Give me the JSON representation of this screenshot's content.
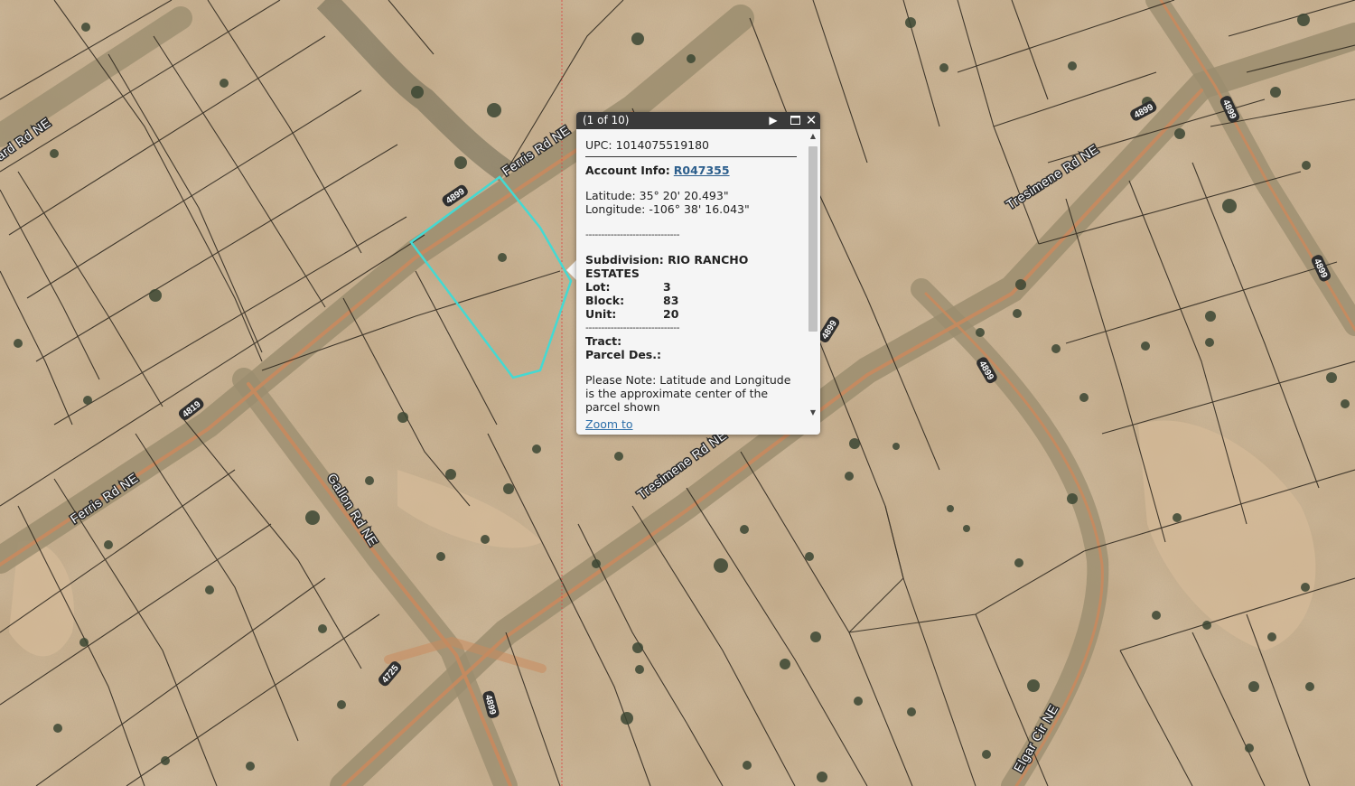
{
  "map": {
    "road_labels": {
      "ferris_top": "Ferris Rd NE",
      "ferris_bottom": "Ferris Rd NE",
      "tresimene_top": "Tresimene Rd NE",
      "tresimene_bottom": "Tresimene Rd NE",
      "gallon": "Gallon Rd NE",
      "elgar": "Elgar Cir NE",
      "partial_left": "ard Rd NE"
    },
    "route_numbers": {
      "r1": "4899",
      "r2": "4899",
      "r3": "4899",
      "r4": "4899",
      "r5": "4899",
      "r6": "4899",
      "r7": "4899",
      "r8": "4819",
      "r9": "4725",
      "r10": "4899"
    },
    "colors": {
      "terrain": "#c3a983",
      "parcel_line": "#1f1a14",
      "selected_parcel": "#3fd6d0",
      "road": "#9a8a6a",
      "dirt_track": "#c98a5d",
      "vegetation": "#3d4a35"
    }
  },
  "popup": {
    "counter": "(1 of 10)",
    "next_icon": "next-arrow-icon",
    "maximize_icon": "maximize-icon",
    "close_icon": "close-icon",
    "upc_label": "UPC:",
    "upc_value": "1014075519180",
    "account_label": "Account Info:",
    "account_value": "R047355",
    "latitude": "Latitude: 35° 20' 20.493\"",
    "longitude": "Longitude: -106° 38' 16.043\"",
    "divider": "------------------------------",
    "subdivision": "Subdivision: RIO RANCHO ESTATES",
    "lot_label": "Lot:",
    "lot_value": "3",
    "block_label": "Block:",
    "block_value": "83",
    "unit_label": "Unit:",
    "unit_value": "20",
    "tract_label": "Tract:",
    "parcel_des_label": "Parcel Des.:",
    "note": "Please Note: Latitude and Longitude is the approximate center of the parcel shown",
    "zoom_link": "Zoom to"
  }
}
